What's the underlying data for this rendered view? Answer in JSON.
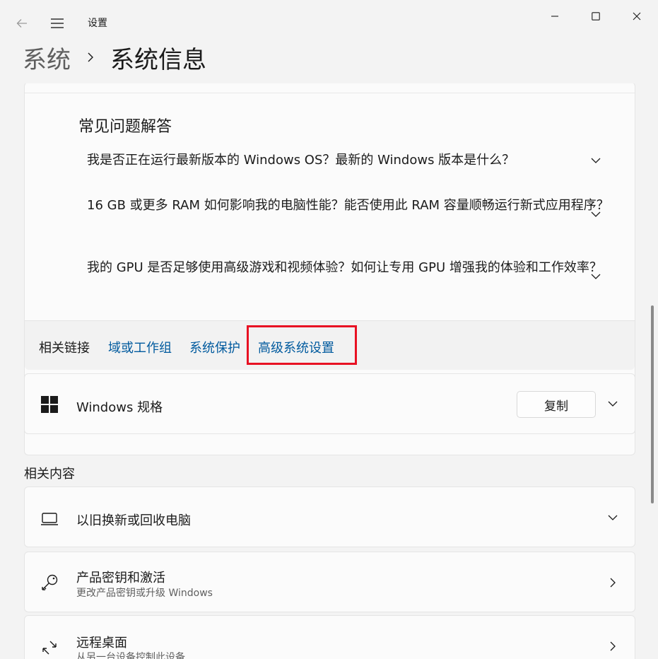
{
  "window": {
    "title": "设置"
  },
  "breadcrumb": {
    "parent": "系统",
    "current": "系统信息"
  },
  "faq": {
    "heading": "常见问题解答",
    "items": [
      {
        "text": "我是否正在运行最新版本的 Windows OS？最新的 Windows 版本是什么？"
      },
      {
        "text": "16 GB 或更多 RAM 如何影响我的电脑性能？能否使用此 RAM 容量顺畅运行新式应用程序？"
      },
      {
        "text": "我的 GPU 是否足够使用高级游戏和视频体验？如何让专用 GPU 增强我的体验和工作效率？"
      }
    ]
  },
  "related_links": {
    "label": "相关链接",
    "links": [
      {
        "label": "域或工作组"
      },
      {
        "label": "系统保护"
      },
      {
        "label": "高级系统设置"
      }
    ],
    "highlight_color": "#e81123"
  },
  "windows_spec": {
    "title": "Windows 规格",
    "copy_label": "复制",
    "icon": "windows-logo-icon"
  },
  "related_content": {
    "heading": "相关内容",
    "items": [
      {
        "title": "以旧换新或回收电脑",
        "subtitle": "",
        "icon": "laptop-icon"
      },
      {
        "title": "产品密钥和激活",
        "subtitle": "更改产品密钥或升级 Windows",
        "icon": "key-icon"
      },
      {
        "title": "远程桌面",
        "subtitle": "从另一台设备控制此设备",
        "icon": "remote-desktop-icon"
      }
    ]
  },
  "colors": {
    "link": "#005a9e",
    "background": "#f3f3f3",
    "card": "#fbfbfb"
  }
}
